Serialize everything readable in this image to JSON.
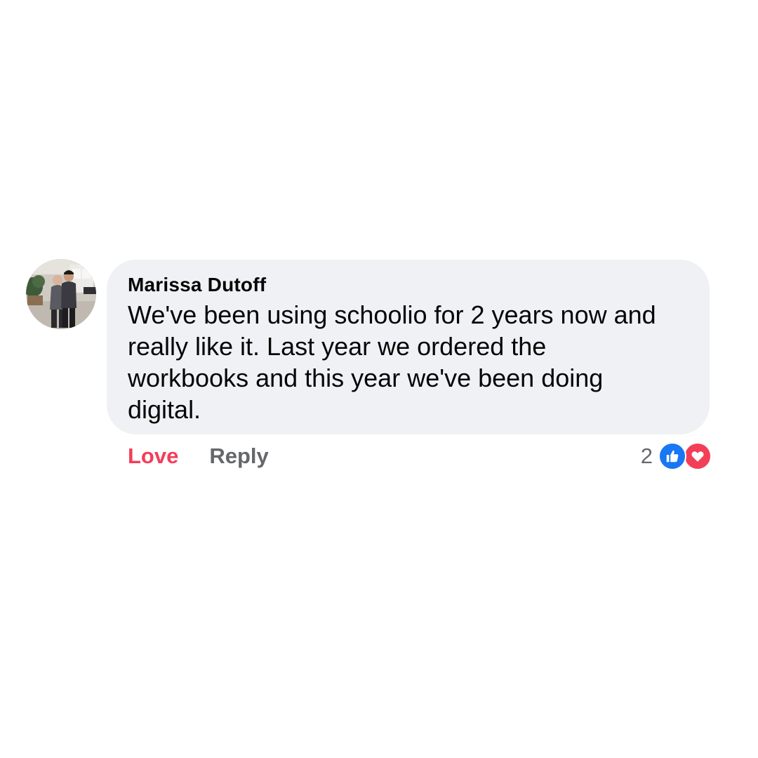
{
  "comment": {
    "author": "Marissa Dutoff",
    "text": "We've been using schoolio for 2 years now and\nreally like it. Last year we ordered the\nworkbooks and this year we've been doing\ndigital."
  },
  "actions": {
    "love_label": "Love",
    "reply_label": "Reply"
  },
  "reactions": {
    "count": "2",
    "icons": [
      "like-icon",
      "love-icon"
    ],
    "like_color": "#1877f2",
    "love_color": "#f33e58"
  },
  "colors": {
    "bubble_bg": "#f0f1f4",
    "love_action": "#f33e58",
    "secondary_text": "#65676b"
  }
}
